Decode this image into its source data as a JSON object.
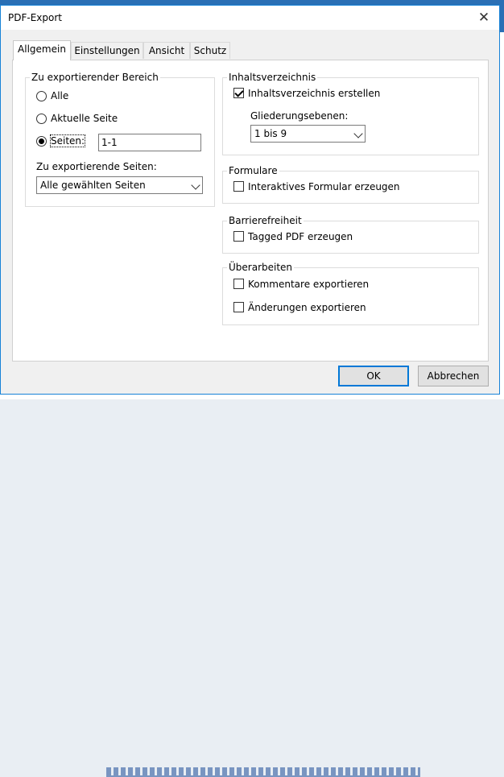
{
  "dialog": {
    "title": "PDF-Export"
  },
  "tabs": [
    "Allgemein",
    "Einstellungen",
    "Ansicht",
    "Schutz"
  ],
  "range": {
    "legend": "Zu exportierender Bereich",
    "options": [
      "Alle",
      "Aktuelle Seite",
      "Seiten:"
    ],
    "selected": "Seiten:",
    "pages_value": "1-1",
    "pages_to_export_label": "Zu exportierende Seiten:",
    "pages_to_export_value": "Alle gewählten Seiten"
  },
  "toc": {
    "legend": "Inhaltsverzeichnis",
    "create_label": "Inhaltsverzeichnis erstellen",
    "create_checked": true,
    "levels_label": "Gliederungsebenen:",
    "levels_value": "1 bis 9"
  },
  "forms": {
    "legend": "Formulare",
    "label": "Interaktives Formular erzeugen",
    "checked": false
  },
  "access": {
    "legend": "Barrierefreiheit",
    "label": "Tagged PDF erzeugen",
    "checked": false
  },
  "review": {
    "legend": "Überarbeiten",
    "comments_label": "Kommentare exportieren",
    "changes_label": "Änderungen exportieren"
  },
  "buttons": {
    "ok": "OK",
    "cancel": "Abbrechen"
  }
}
